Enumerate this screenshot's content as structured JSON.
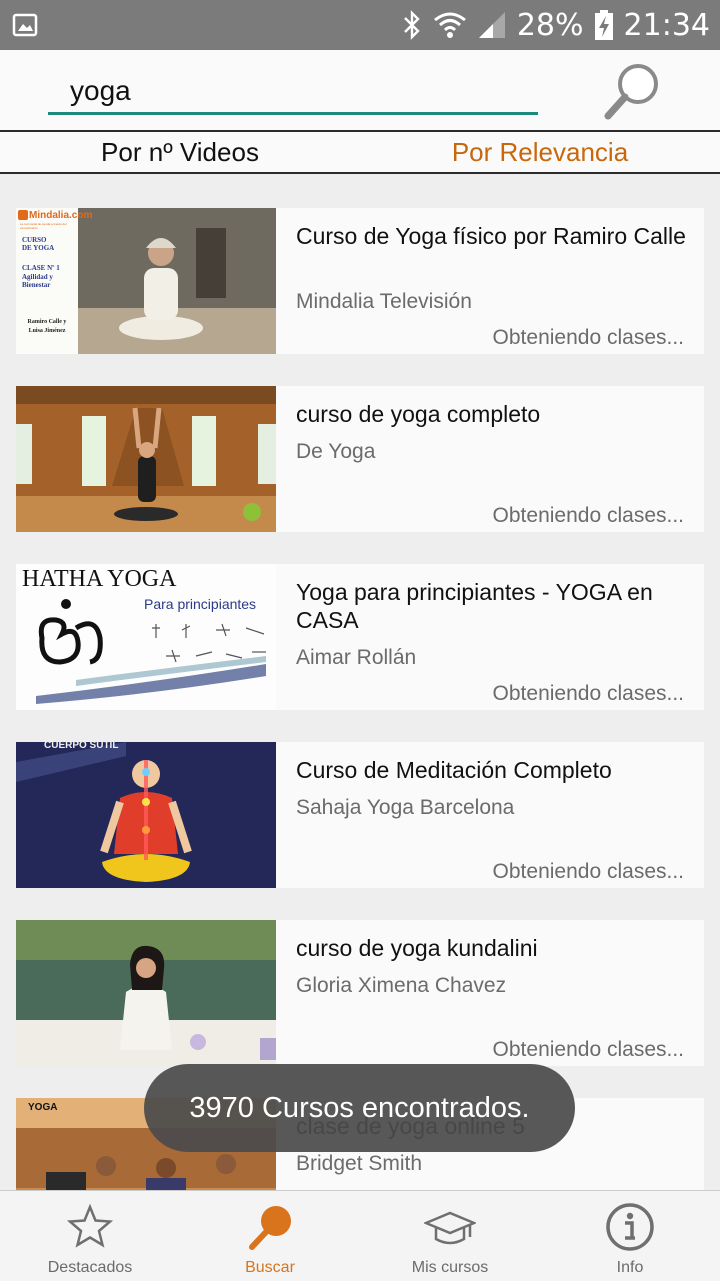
{
  "statusbar": {
    "battery": "28%",
    "time": "21:34"
  },
  "search": {
    "query": "yoga",
    "placeholder": ""
  },
  "sort_tabs": [
    {
      "label": "Por nº Videos",
      "active": false
    },
    {
      "label": "Por Relevancia",
      "active": true
    }
  ],
  "courses": [
    {
      "title": "Curso de Yoga físico por Ramiro Calle",
      "author": "Mindalia Televisión",
      "status": "Obteniendo clases...",
      "thumb_text": {
        "brand": "Mindalia.com",
        "brand_sub": "La red social de ayuda a través del conocimiento",
        "course": "CURSO DE YOGA",
        "clase": "CLASE Nº 1",
        "subtitle": "Agilidad y Bienestar",
        "authors": "Ramiro Calle y Luisa Jiménez"
      }
    },
    {
      "title": "curso de yoga completo",
      "author": "De Yoga",
      "status": "Obteniendo clases..."
    },
    {
      "title": "Yoga para principiantes - YOGA en CASA",
      "author": "Aimar Rollán",
      "status": "Obteniendo clases...",
      "thumb_text": {
        "heading": "HATHA YOGA",
        "sub": "Para principiantes"
      }
    },
    {
      "title": "Curso de Meditación Completo",
      "author": "Sahaja Yoga Barcelona",
      "status": "Obteniendo clases...",
      "thumb_text": {
        "heading": "CUERPO SUTIL"
      }
    },
    {
      "title": "curso de yoga kundalini",
      "author": "Gloria Ximena Chavez",
      "status": "Obteniendo clases..."
    },
    {
      "title": "clase de yoga online 5",
      "author": "Bridget Smith",
      "status": "",
      "thumb_text": {
        "heading": "YOGA"
      }
    }
  ],
  "toast": "3970 Cursos encontrados.",
  "bottom_nav": [
    {
      "label": "Destacados",
      "icon": "star-icon",
      "active": false
    },
    {
      "label": "Buscar",
      "icon": "search-icon",
      "active": true
    },
    {
      "label": "Mis cursos",
      "icon": "graduation-cap-icon",
      "active": false
    },
    {
      "label": "Info",
      "icon": "info-icon",
      "active": false
    }
  ],
  "colors": {
    "accent": "#d9741d",
    "active_tab": "#c8680c",
    "search_underline": "#1c8a7a",
    "statusbar": "#7b7b7b"
  }
}
